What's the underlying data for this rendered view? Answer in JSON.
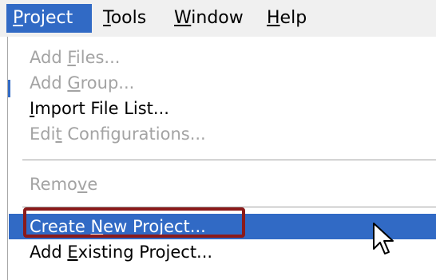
{
  "menubar": {
    "items": [
      {
        "pre": "",
        "key": "P",
        "post": "roject",
        "active": true
      },
      {
        "pre": "",
        "key": "T",
        "post": "ools",
        "active": false
      },
      {
        "pre": "",
        "key": "W",
        "post": "indow",
        "active": false
      },
      {
        "pre": "",
        "key": "H",
        "post": "elp",
        "active": false
      }
    ]
  },
  "project_menu": {
    "items": [
      {
        "pre": "Add ",
        "key": "F",
        "post": "iles...",
        "enabled": false
      },
      {
        "pre": "Add ",
        "key": "G",
        "post": "roup...",
        "enabled": false
      },
      {
        "pre": "",
        "key": "I",
        "post": "mport File List...",
        "enabled": true
      },
      {
        "pre": "Edi",
        "key": "t",
        "post": " Configurations...",
        "enabled": false
      },
      {
        "pre": "Remo",
        "key": "v",
        "post": "e",
        "enabled": false
      },
      {
        "pre": "Create ",
        "key": "N",
        "post": "ew Project...",
        "enabled": true,
        "highlighted": true
      },
      {
        "pre": "Add ",
        "key": "E",
        "post": "xisting Project...",
        "enabled": true
      }
    ]
  },
  "colors": {
    "highlight": "#316ac5",
    "disabled_text": "#a3a3a3",
    "annotation": "#8b1a1a"
  },
  "cursor_icon": "mouse-pointer-arrow-icon"
}
